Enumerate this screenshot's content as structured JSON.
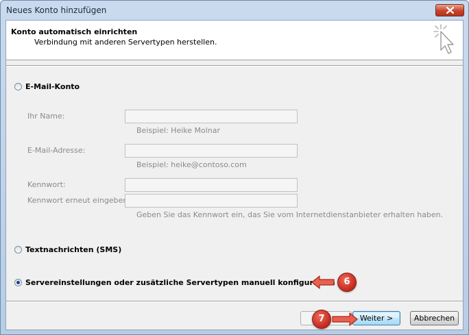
{
  "window": {
    "title": "Neues Konto hinzufügen"
  },
  "header": {
    "title": "Konto automatisch einrichten",
    "subtitle": "Verbindung mit anderen Servertypen herstellen."
  },
  "options": {
    "email": {
      "label": "E-Mail-Konto",
      "selected": false
    },
    "sms": {
      "label": "Textnachrichten (SMS)",
      "selected": false
    },
    "manual": {
      "label": "Servereinstellungen oder zusätzliche Servertypen manuell konfigurieren",
      "selected": true
    }
  },
  "form": {
    "name_label": "Ihr Name:",
    "name_value": "",
    "name_hint": "Beispiel: Heike Molnar",
    "email_label": "E-Mail-Adresse:",
    "email_value": "",
    "email_hint": "Beispiel: heike@contoso.com",
    "password_label": "Kennwort:",
    "password_value": "",
    "password_repeat_label": "Kennwort erneut eingeben:",
    "password_repeat_value": "",
    "password_hint": "Geben Sie das Kennwort ein, das Sie vom Internetdienstanbieter erhalten haben."
  },
  "buttons": {
    "back": "",
    "next": "Weiter >",
    "cancel": "Abbrechen"
  },
  "annotations": {
    "step6": "6",
    "step7": "7"
  },
  "colors": {
    "badge": "#c2281c",
    "arrow": "#d9453a",
    "titlebar": "#c9daee"
  }
}
